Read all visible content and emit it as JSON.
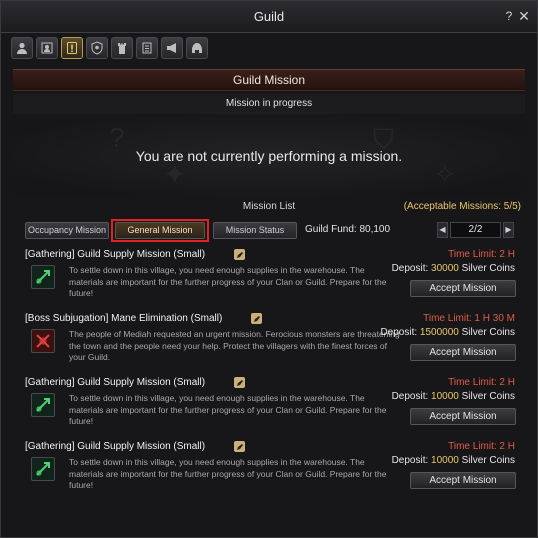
{
  "window": {
    "title": "Guild",
    "help_label": "?",
    "close_label": "✕"
  },
  "tabs": [
    {
      "icon": "person-icon",
      "active": false
    },
    {
      "icon": "members-icon",
      "active": false
    },
    {
      "icon": "exclamation-icon",
      "active": true
    },
    {
      "icon": "emblem-icon",
      "active": false
    },
    {
      "icon": "tower-icon",
      "active": false
    },
    {
      "icon": "scroll-icon",
      "active": false
    },
    {
      "icon": "horn-icon",
      "active": false
    },
    {
      "icon": "helmet-icon",
      "active": false
    }
  ],
  "header": {
    "title": "Guild Mission",
    "progress_label": "Mission in progress"
  },
  "status": {
    "message": "You are not currently performing a mission."
  },
  "mission_list": {
    "title": "Mission List",
    "acceptable": "(Acceptable Missions: 5/5)",
    "filters": {
      "occupancy": "Occupancy Mission",
      "general": "General Mission",
      "status": "Mission Status"
    },
    "guild_fund_label": "Guild Fund: 80,100",
    "pager": {
      "prev": "◀",
      "value": "2/2",
      "next": "▶"
    }
  },
  "missions": [
    {
      "name": "[Gathering] Guild Supply Mission (Small)",
      "icon": "gathering-icon",
      "description": "To settle down in this village, you need enough supplies in the warehouse. The materials are important for the further progress of your Clan or Guild. Prepare for the future!",
      "time_limit": "Time Limit: 2 H",
      "deposit_label": "Deposit:",
      "deposit_amount": "30000",
      "deposit_unit": "Silver Coins",
      "accept": "Accept Mission"
    },
    {
      "name": "[Boss Subjugation] Mane Elimination (Small)",
      "icon": "boss-icon",
      "description": "The people of Mediah requested an urgent mission. Ferocious monsters are threatening the town and the people need your help. Protect the villagers with the finest forces of your Guild.",
      "time_limit": "Time Limit: 1 H 30 M",
      "deposit_label": "Deposit:",
      "deposit_amount": "1500000",
      "deposit_unit": "Silver Coins",
      "accept": "Accept Mission"
    },
    {
      "name": "[Gathering] Guild Supply Mission (Small)",
      "icon": "gathering-icon",
      "description": "To settle down in this village, you need enough supplies in the warehouse. The materials are important for the further progress of your Clan or Guild. Prepare for the future!",
      "time_limit": "Time Limit: 2 H",
      "deposit_label": "Deposit:",
      "deposit_amount": "10000",
      "deposit_unit": "Silver Coins",
      "accept": "Accept Mission"
    },
    {
      "name": "[Gathering] Guild Supply Mission (Small)",
      "icon": "gathering-icon",
      "description": "To settle down in this village, you need enough supplies in the warehouse. The materials are important for the further progress of your Clan or Guild. Prepare for the future!",
      "time_limit": "Time Limit: 2 H",
      "deposit_label": "Deposit:",
      "deposit_amount": "10000",
      "deposit_unit": "Silver Coins",
      "accept": "Accept Mission"
    }
  ],
  "colors": {
    "accent_gold": "#e8c76a",
    "time_limit_red": "#e25a4a",
    "highlight_red": "#e02424"
  }
}
